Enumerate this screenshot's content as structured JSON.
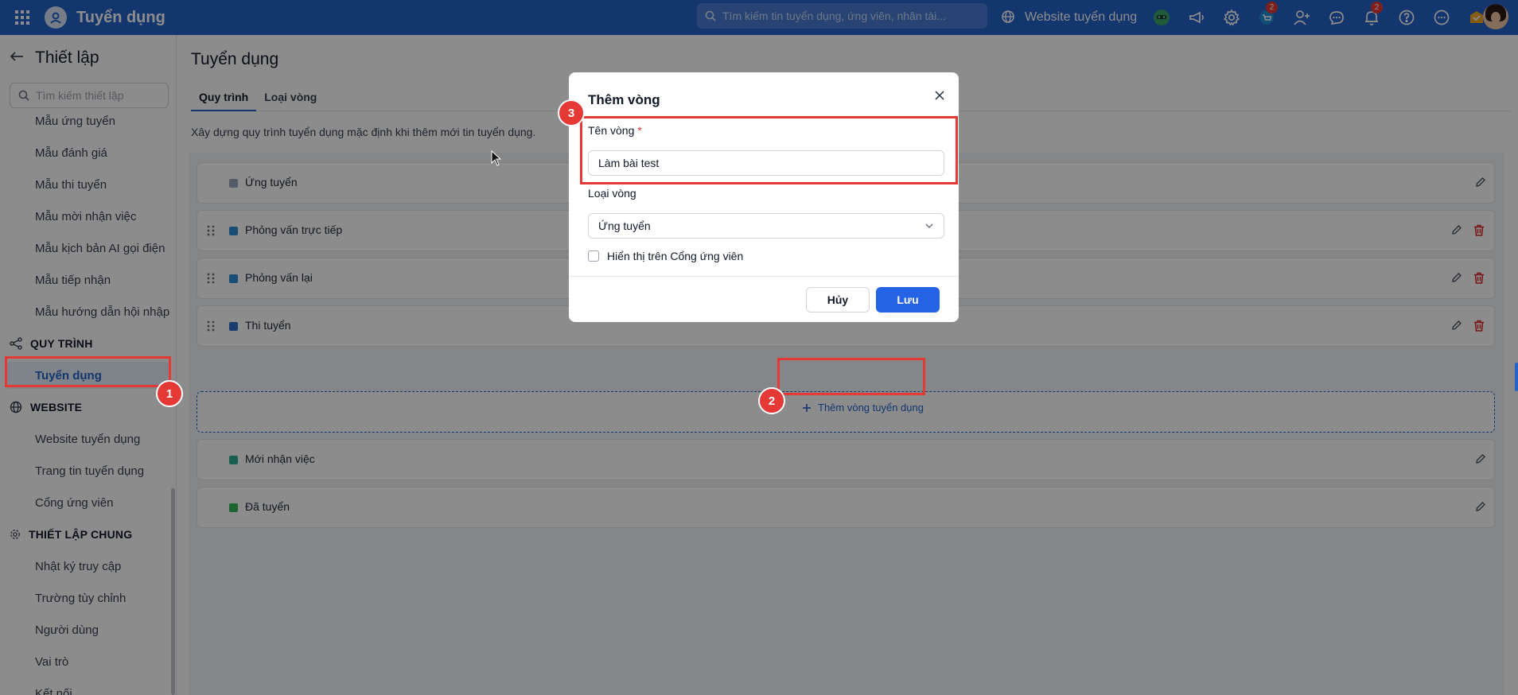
{
  "topbar": {
    "app_title": "Tuyển dụng",
    "search_placeholder": "Tìm kiếm tin tuyển dụng, ứng viên, nhân tài...",
    "website_link": "Website tuyển dụng",
    "cart_badge": "2",
    "bell_badge": "2"
  },
  "sidebar": {
    "title": "Thiết lập",
    "search_placeholder": "Tìm kiếm thiết lập",
    "items_top": [
      "Mẫu ứng tuyển",
      "Mẫu đánh giá",
      "Mẫu thi tuyển",
      "Mẫu mời nhận việc",
      "Mẫu kịch bản AI gọi điện",
      "Mẫu tiếp nhận",
      "Mẫu hướng dẫn hội nhập"
    ],
    "section_process": "QUY TRÌNH",
    "process_active": "Tuyển dụng",
    "section_website": "WEBSITE",
    "website_items": [
      "Website tuyển dụng",
      "Trang tin tuyển dụng",
      "Cổng ứng viên"
    ],
    "section_general": "THIẾT LẬP CHUNG",
    "general_items": [
      "Nhật ký truy cập",
      "Trường tùy chỉnh",
      "Người dùng",
      "Vai trò",
      "Kết nối"
    ]
  },
  "main": {
    "title": "Tuyển dụng",
    "tabs": [
      "Quy trình",
      "Loại vòng"
    ],
    "description": "Xây dựng quy trình tuyển dụng mặc định khi thêm mới tin tuyển dụng.",
    "stages": [
      {
        "label": "Ứng tuyển",
        "color": "#9aa9b8"
      },
      {
        "label": "Phỏng vấn trực tiếp",
        "color": "#2f8fd8"
      },
      {
        "label": "Phỏng vấn lại",
        "color": "#2f8fd8"
      },
      {
        "label": "Thi tuyển",
        "color": "#2f6fc8"
      },
      {
        "label": "Mới nhận việc",
        "color": "#2fae8f"
      },
      {
        "label": "Đã tuyển",
        "color": "#34b85a"
      }
    ],
    "add_stage_label": "Thêm vòng tuyển dụng"
  },
  "modal": {
    "title": "Thêm vòng",
    "name_label": "Tên vòng",
    "required_mark": "*",
    "name_value": "Làm bài test",
    "type_label": "Loại vòng",
    "type_value": "Ứng tuyển",
    "checkbox_label": "Hiển thị trên Cổng ứng viên",
    "cancel_label": "Hủy",
    "save_label": "Lưu"
  },
  "annotations": {
    "marker_1": "1",
    "marker_2": "2",
    "marker_3": "3",
    "highlight_color": "#e53935"
  }
}
